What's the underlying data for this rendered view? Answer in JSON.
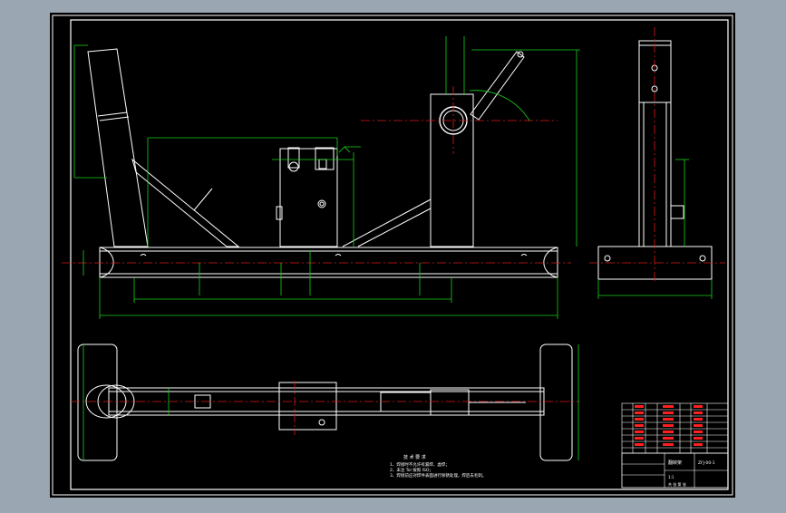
{
  "drawing": {
    "tech_requirements_title": "技 术 要 求",
    "tech_requirements": [
      "1、焊接时不允许有漏焊、虚焊；",
      "2、未注 Tol 按照 ISO；",
      "3、焊接前应对焊件表面进行除锈处理，焊后去毛刺。"
    ],
    "title_block": {
      "part_name": "翻转架",
      "scale": "1:1",
      "drawing_no": "ZFJ-00-1",
      "sheet": "共 张 第 张"
    },
    "colors": {
      "background": "#000000",
      "frame": "#ffffff",
      "dimension": "#19d219",
      "centerline": "#e01818",
      "bom_text": "#ff2020"
    }
  }
}
